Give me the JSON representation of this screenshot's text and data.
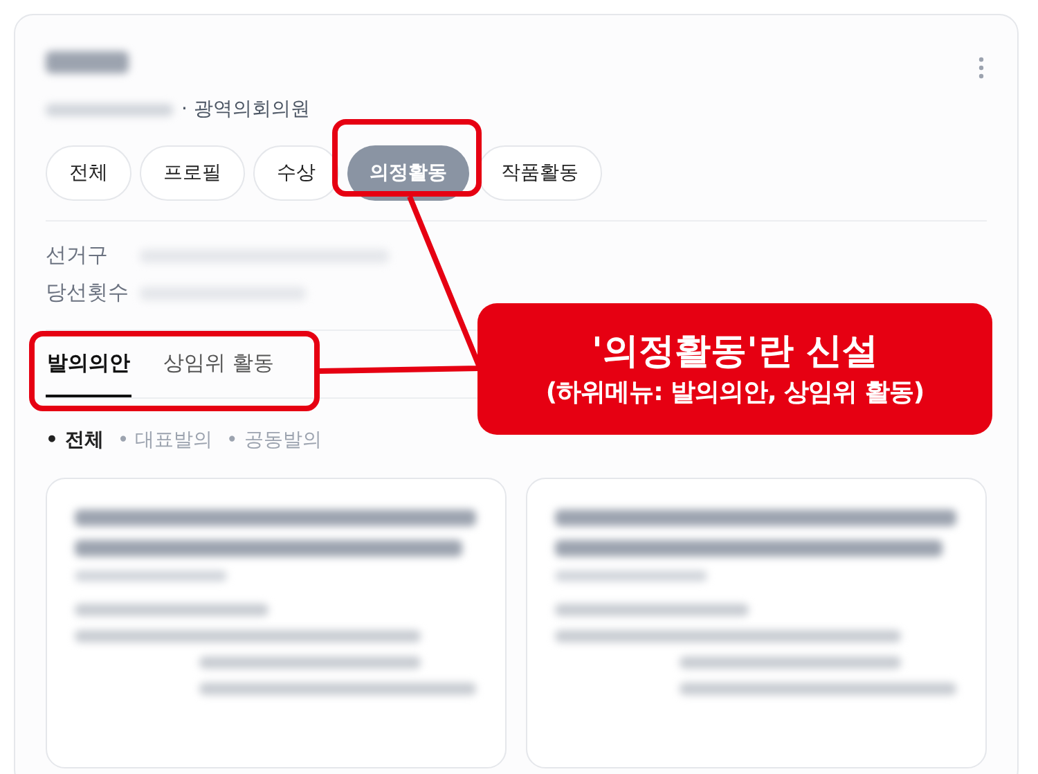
{
  "profile": {
    "subtitle": "· 광역의회의원"
  },
  "tabs": [
    {
      "label": "전체",
      "selected": false
    },
    {
      "label": "프로필",
      "selected": false
    },
    {
      "label": "수상",
      "selected": false
    },
    {
      "label": "의정활동",
      "selected": true
    },
    {
      "label": "작품활동",
      "selected": false
    }
  ],
  "info": [
    {
      "label": "선거구"
    },
    {
      "label": "당선횟수"
    }
  ],
  "subtabs": [
    {
      "label": "발의의안",
      "selected": true
    },
    {
      "label": "상임위 활동",
      "selected": false
    }
  ],
  "filters": [
    {
      "label": "• 전체",
      "selected": true
    },
    {
      "label": "• 대표발의",
      "selected": false
    },
    {
      "label": "• 공동발의",
      "selected": false
    }
  ],
  "annotation": {
    "title": "'의정활동'란 신설",
    "subtitle": "(하위메뉴: 발의의안, 상임위 활동)"
  }
}
